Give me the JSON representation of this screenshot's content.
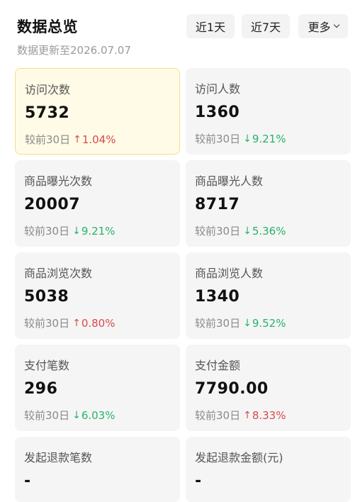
{
  "header": {
    "title": "数据总览",
    "subtitle": "数据更新至2026.07.07",
    "filters": {
      "day1": "近1天",
      "day7": "近7天",
      "more": "更多"
    }
  },
  "compare_label": "较前30日",
  "cards": [
    {
      "label": "访问次数",
      "value": "5732",
      "direction": "up",
      "arrow": "↑",
      "pct": "1.04%",
      "active": true
    },
    {
      "label": "访问人数",
      "value": "1360",
      "direction": "down",
      "arrow": "↓",
      "pct": "9.21%",
      "active": false
    },
    {
      "label": "商品曝光次数",
      "value": "20007",
      "direction": "down",
      "arrow": "↓",
      "pct": "9.21%",
      "active": false
    },
    {
      "label": "商品曝光人数",
      "value": "8717",
      "direction": "down",
      "arrow": "↓",
      "pct": "5.36%",
      "active": false
    },
    {
      "label": "商品浏览次数",
      "value": "5038",
      "direction": "up",
      "arrow": "↑",
      "pct": "0.80%",
      "active": false
    },
    {
      "label": "商品浏览人数",
      "value": "1340",
      "direction": "down",
      "arrow": "↓",
      "pct": "9.52%",
      "active": false
    },
    {
      "label": "支付笔数",
      "value": "296",
      "direction": "down",
      "arrow": "↓",
      "pct": "6.03%",
      "active": false
    },
    {
      "label": "支付金额",
      "value": "7790.00",
      "direction": "up",
      "arrow": "↑",
      "pct": "8.33%",
      "active": false
    },
    {
      "label": "发起退款笔数",
      "value": "-",
      "direction": "",
      "arrow": "",
      "pct": "",
      "active": false
    },
    {
      "label": "发起退款金额(元)",
      "value": "-",
      "direction": "",
      "arrow": "",
      "pct": "",
      "active": false
    }
  ],
  "colors": {
    "up": "#d84a4a",
    "down": "#27b36b",
    "active_bg": "#fffbe6",
    "active_border": "#f3dd8c"
  }
}
